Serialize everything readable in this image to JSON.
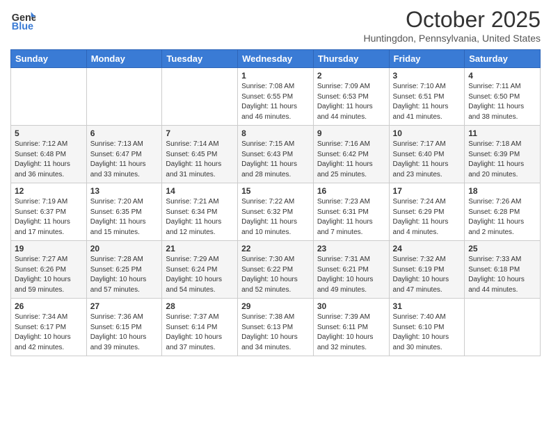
{
  "header": {
    "logo_general": "General",
    "logo_blue": "Blue",
    "month_title": "October 2025",
    "location": "Huntingdon, Pennsylvania, United States"
  },
  "weekdays": [
    "Sunday",
    "Monday",
    "Tuesday",
    "Wednesday",
    "Thursday",
    "Friday",
    "Saturday"
  ],
  "weeks": [
    [
      {
        "day": "",
        "info": ""
      },
      {
        "day": "",
        "info": ""
      },
      {
        "day": "",
        "info": ""
      },
      {
        "day": "1",
        "info": "Sunrise: 7:08 AM\nSunset: 6:55 PM\nDaylight: 11 hours\nand 46 minutes."
      },
      {
        "day": "2",
        "info": "Sunrise: 7:09 AM\nSunset: 6:53 PM\nDaylight: 11 hours\nand 44 minutes."
      },
      {
        "day": "3",
        "info": "Sunrise: 7:10 AM\nSunset: 6:51 PM\nDaylight: 11 hours\nand 41 minutes."
      },
      {
        "day": "4",
        "info": "Sunrise: 7:11 AM\nSunset: 6:50 PM\nDaylight: 11 hours\nand 38 minutes."
      }
    ],
    [
      {
        "day": "5",
        "info": "Sunrise: 7:12 AM\nSunset: 6:48 PM\nDaylight: 11 hours\nand 36 minutes."
      },
      {
        "day": "6",
        "info": "Sunrise: 7:13 AM\nSunset: 6:47 PM\nDaylight: 11 hours\nand 33 minutes."
      },
      {
        "day": "7",
        "info": "Sunrise: 7:14 AM\nSunset: 6:45 PM\nDaylight: 11 hours\nand 31 minutes."
      },
      {
        "day": "8",
        "info": "Sunrise: 7:15 AM\nSunset: 6:43 PM\nDaylight: 11 hours\nand 28 minutes."
      },
      {
        "day": "9",
        "info": "Sunrise: 7:16 AM\nSunset: 6:42 PM\nDaylight: 11 hours\nand 25 minutes."
      },
      {
        "day": "10",
        "info": "Sunrise: 7:17 AM\nSunset: 6:40 PM\nDaylight: 11 hours\nand 23 minutes."
      },
      {
        "day": "11",
        "info": "Sunrise: 7:18 AM\nSunset: 6:39 PM\nDaylight: 11 hours\nand 20 minutes."
      }
    ],
    [
      {
        "day": "12",
        "info": "Sunrise: 7:19 AM\nSunset: 6:37 PM\nDaylight: 11 hours\nand 17 minutes."
      },
      {
        "day": "13",
        "info": "Sunrise: 7:20 AM\nSunset: 6:35 PM\nDaylight: 11 hours\nand 15 minutes."
      },
      {
        "day": "14",
        "info": "Sunrise: 7:21 AM\nSunset: 6:34 PM\nDaylight: 11 hours\nand 12 minutes."
      },
      {
        "day": "15",
        "info": "Sunrise: 7:22 AM\nSunset: 6:32 PM\nDaylight: 11 hours\nand 10 minutes."
      },
      {
        "day": "16",
        "info": "Sunrise: 7:23 AM\nSunset: 6:31 PM\nDaylight: 11 hours\nand 7 minutes."
      },
      {
        "day": "17",
        "info": "Sunrise: 7:24 AM\nSunset: 6:29 PM\nDaylight: 11 hours\nand 4 minutes."
      },
      {
        "day": "18",
        "info": "Sunrise: 7:26 AM\nSunset: 6:28 PM\nDaylight: 11 hours\nand 2 minutes."
      }
    ],
    [
      {
        "day": "19",
        "info": "Sunrise: 7:27 AM\nSunset: 6:26 PM\nDaylight: 10 hours\nand 59 minutes."
      },
      {
        "day": "20",
        "info": "Sunrise: 7:28 AM\nSunset: 6:25 PM\nDaylight: 10 hours\nand 57 minutes."
      },
      {
        "day": "21",
        "info": "Sunrise: 7:29 AM\nSunset: 6:24 PM\nDaylight: 10 hours\nand 54 minutes."
      },
      {
        "day": "22",
        "info": "Sunrise: 7:30 AM\nSunset: 6:22 PM\nDaylight: 10 hours\nand 52 minutes."
      },
      {
        "day": "23",
        "info": "Sunrise: 7:31 AM\nSunset: 6:21 PM\nDaylight: 10 hours\nand 49 minutes."
      },
      {
        "day": "24",
        "info": "Sunrise: 7:32 AM\nSunset: 6:19 PM\nDaylight: 10 hours\nand 47 minutes."
      },
      {
        "day": "25",
        "info": "Sunrise: 7:33 AM\nSunset: 6:18 PM\nDaylight: 10 hours\nand 44 minutes."
      }
    ],
    [
      {
        "day": "26",
        "info": "Sunrise: 7:34 AM\nSunset: 6:17 PM\nDaylight: 10 hours\nand 42 minutes."
      },
      {
        "day": "27",
        "info": "Sunrise: 7:36 AM\nSunset: 6:15 PM\nDaylight: 10 hours\nand 39 minutes."
      },
      {
        "day": "28",
        "info": "Sunrise: 7:37 AM\nSunset: 6:14 PM\nDaylight: 10 hours\nand 37 minutes."
      },
      {
        "day": "29",
        "info": "Sunrise: 7:38 AM\nSunset: 6:13 PM\nDaylight: 10 hours\nand 34 minutes."
      },
      {
        "day": "30",
        "info": "Sunrise: 7:39 AM\nSunset: 6:11 PM\nDaylight: 10 hours\nand 32 minutes."
      },
      {
        "day": "31",
        "info": "Sunrise: 7:40 AM\nSunset: 6:10 PM\nDaylight: 10 hours\nand 30 minutes."
      },
      {
        "day": "",
        "info": ""
      }
    ]
  ]
}
